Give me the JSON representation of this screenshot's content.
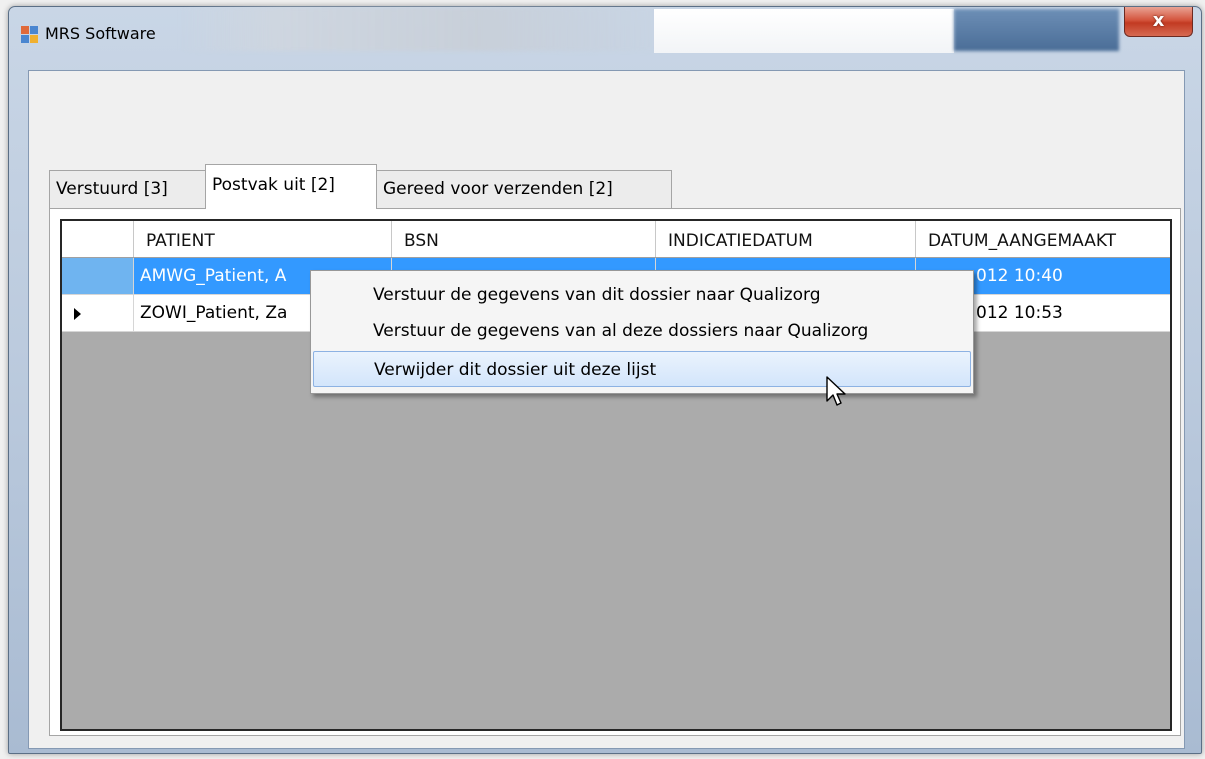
{
  "window": {
    "title": "MRS Software",
    "close_label": "x"
  },
  "tabs": [
    {
      "label": "Verstuurd [3]",
      "active": false
    },
    {
      "label": "Postvak uit [2]",
      "active": true
    },
    {
      "label": "Gereed voor verzenden [2]",
      "active": false
    }
  ],
  "grid": {
    "columns": [
      "PATIENT",
      "BSN",
      "INDICATIEDATUM",
      "DATUM_AANGEMAAKT"
    ],
    "rows": [
      {
        "patient": "AMWG_Patient, A",
        "bsn": "",
        "indicatiedatum": "",
        "datum_aangemaakt": "012 10:40",
        "selected": true
      },
      {
        "patient": "ZOWI_Patient, Za",
        "bsn": "",
        "indicatiedatum": "",
        "datum_aangemaakt": "012 10:53",
        "selected": false
      }
    ]
  },
  "context_menu": {
    "items": [
      "Verstuur de gegevens van dit dossier naar Qualizorg",
      "Verstuur de gegevens van al deze dossiers naar Qualizorg",
      "Verwijder dit dossier uit deze lijst"
    ],
    "highlighted_index": 2
  },
  "colors": {
    "selection": "#3399ff",
    "grid_background": "#ababab",
    "menu_highlight_border": "#8db2e3"
  }
}
